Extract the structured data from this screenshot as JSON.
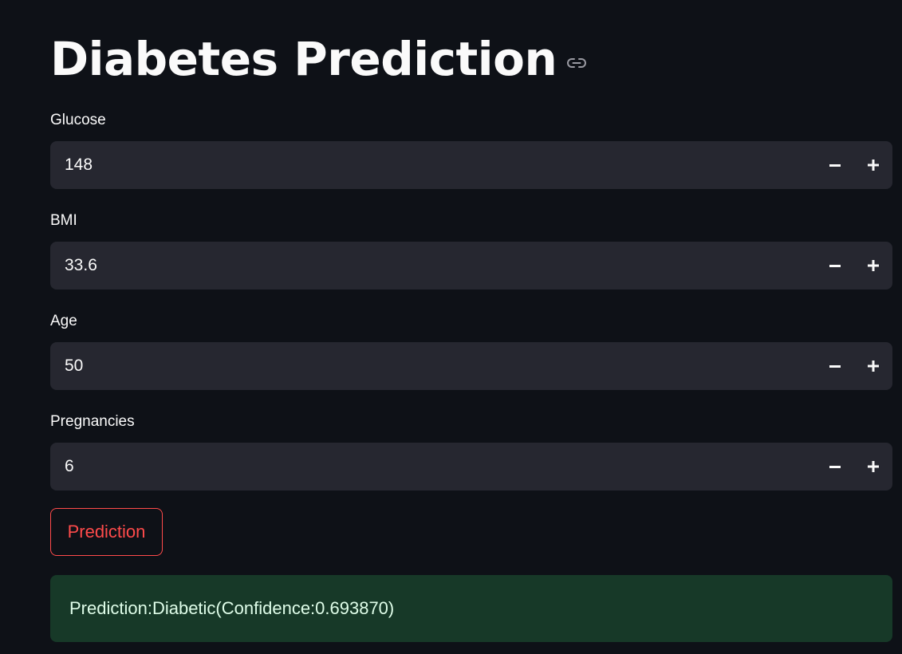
{
  "header": {
    "title": "Diabetes Prediction",
    "link_icon": "link-icon"
  },
  "fields": [
    {
      "label": "Glucose",
      "value": "148"
    },
    {
      "label": "BMI",
      "value": "33.6"
    },
    {
      "label": "Age",
      "value": "50"
    },
    {
      "label": "Pregnancies",
      "value": "6"
    }
  ],
  "stepper": {
    "decrement_icon": "minus-icon",
    "increment_icon": "plus-icon"
  },
  "actions": {
    "predict_label": "Prediction"
  },
  "result": {
    "text": "Prediction:Diabetic(Confidence:0.693870)"
  },
  "colors": {
    "background": "#0e1117",
    "input_background": "#262730",
    "accent": "#ff4b4b",
    "success_background": "#173928",
    "success_text": "#dffde9"
  }
}
